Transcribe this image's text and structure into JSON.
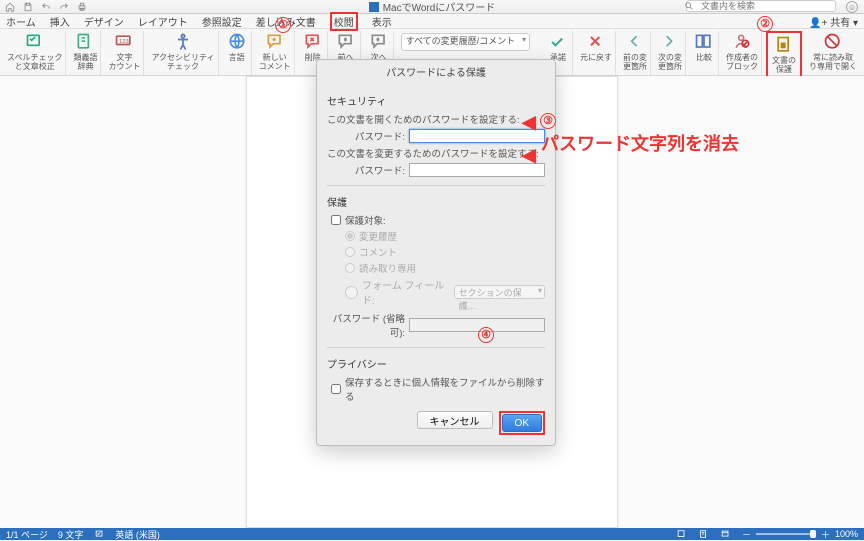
{
  "title": "MacでWordにパスワード",
  "search": {
    "placeholder": "文書内を検索"
  },
  "tabs": [
    "ホーム",
    "挿入",
    "デザイン",
    "レイアウト",
    "参照設定",
    "差し込み文書",
    "校閲",
    "表示"
  ],
  "share": "共有",
  "ribbon": {
    "spellcheck": "スペルチェック\nと文章校正",
    "thesaurus": "類義語\n辞典",
    "wordcount": "文字\nカウント",
    "a11y": "アクセシビリティ\nチェック",
    "language": "言語",
    "newcomment": "新しい\nコメント",
    "delete": "削除",
    "prev": "前へ",
    "next": "次へ",
    "dropdown": "すべての変更履歴/コメント",
    "approve": "承諾",
    "revert": "元に戻す",
    "prevchange": "前の変\n更箇所",
    "nextchange": "次の変\n更箇所",
    "compare": "比較",
    "blockauthor": "作成者の\nブロック",
    "protect": "文書の\n保護",
    "readonly": "常に読み取\nり専用で開く"
  },
  "dialog": {
    "title": "パスワードによる保護",
    "sec_security": "セキュリティ",
    "open_text": "この文書を開くためのパスワードを設定する:",
    "pw_label": "パスワード:",
    "modify_text": "この文書を変更するためのパスワードを設定する:",
    "sec_protect": "保護",
    "target": "保護対象:",
    "r1": "変更履歴",
    "r2": "コメント",
    "r3": "読み取り専用",
    "r4": "フォーム フィールド:",
    "ff_dd": "セクションの保護...",
    "pw_opt_label": "パスワード (省略可):",
    "sec_privacy": "プライバシー",
    "priv_ck": "保存するときに個人情報をファイルから削除する",
    "cancel": "キャンセル",
    "ok": "OK"
  },
  "annot": {
    "n1": "①",
    "n2": "②",
    "n3": "③",
    "n4": "④",
    "text3": "パスワード文字列を消去",
    "arrow": "◀"
  },
  "status": {
    "pages": "1/1 ページ",
    "words": "9 文字",
    "lang": "英語 (米国)",
    "zoom": "100%",
    "minus": "－",
    "plus": "＋"
  }
}
